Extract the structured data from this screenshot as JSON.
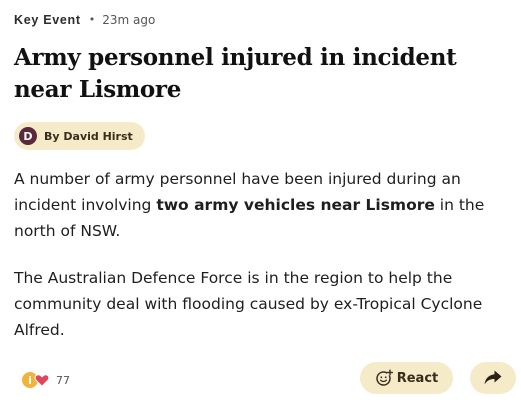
{
  "post": {
    "label": "Key Event",
    "separator": "•",
    "time_ago": "23m ago",
    "headline": "Army personnel injured in incident near Lismore",
    "author": {
      "initial": "D",
      "byline": "By David Hirst",
      "avatar_color": "#5a2a3c"
    },
    "paragraph1": {
      "before": "A number of army personnel have been injured during an incident involving ",
      "bold": "two army vehicles near Lismore",
      "after": " in the north of NSW."
    },
    "paragraph2": "The Australian Defence Force is in the region to help the community deal with flooding caused by ex-Tropical Cyclone Alfred."
  },
  "reactions": {
    "icons": [
      "info-emoji-icon",
      "heart-emoji-icon"
    ],
    "info_glyph": "i",
    "count": "77",
    "react_label": "React",
    "react_icon": "smiley-plus-icon",
    "share_icon": "share-arrow-icon"
  },
  "colors": {
    "pill_background": "#f6ebc9",
    "heart": "#e2445c",
    "info_emoji": "#f2b33d"
  }
}
